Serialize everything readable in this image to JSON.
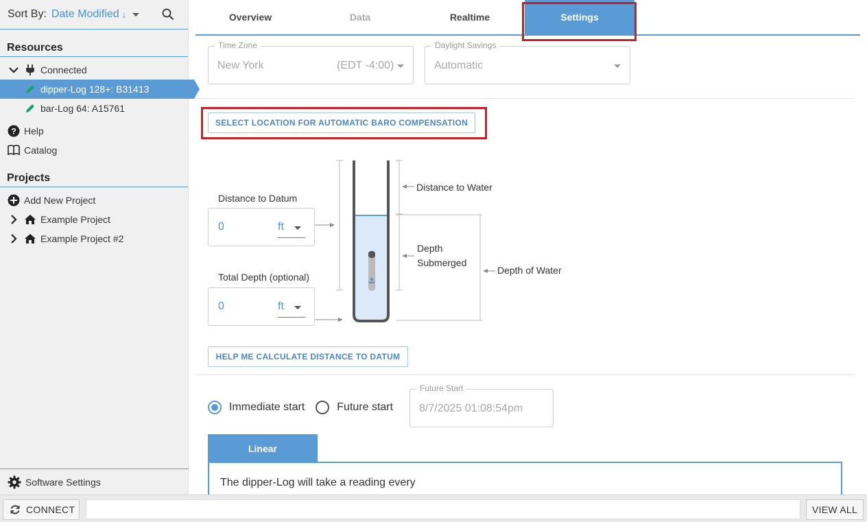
{
  "sidebar": {
    "sort_label": "Sort By:",
    "sort_value": "Date Modified",
    "sort_direction_glyph": "↓",
    "resources_title": "Resources",
    "resources": [
      {
        "label": "Connected",
        "icon": "plug-icon",
        "expanded": true
      },
      {
        "label": "dipper-Log 128+: B31413",
        "icon": "pencil-icon",
        "selected": true
      },
      {
        "label": "bar-Log 64: A15761",
        "icon": "pencil-icon"
      },
      {
        "label": "Help",
        "icon": "help-circle-icon"
      },
      {
        "label": "Catalog",
        "icon": "book-icon"
      }
    ],
    "projects_title": "Projects",
    "projects": [
      {
        "label": "Add New Project",
        "icon": "plus-circle-icon"
      },
      {
        "label": "Example Project",
        "icon": "home-icon"
      },
      {
        "label": "Example Project #2",
        "icon": "home-icon"
      }
    ],
    "software_settings": "Software Settings"
  },
  "tabs": [
    {
      "label": "Overview",
      "state": "normal"
    },
    {
      "label": "Data",
      "state": "disabled"
    },
    {
      "label": "Realtime",
      "state": "normal"
    },
    {
      "label": "Settings",
      "state": "active"
    }
  ],
  "settings": {
    "timezone": {
      "label": "Time Zone",
      "value": "New York",
      "offset": "(EDT -4:00)"
    },
    "daylight": {
      "label": "Daylight Savings",
      "value": "Automatic"
    },
    "baro_button": "SELECT LOCATION FOR AUTOMATIC BARO COMPENSATION",
    "distance_to_datum": {
      "label": "Distance to Datum",
      "value": "0",
      "unit": "ft"
    },
    "total_depth": {
      "label": "Total Depth (optional)",
      "value": "0",
      "unit": "ft"
    },
    "diagram": {
      "distance_to_water": "Distance to Water",
      "depth_submerged_1": "Depth",
      "depth_submerged_2": "Submerged",
      "depth_of_water": "Depth of Water"
    },
    "help_button": "HELP ME CALCULATE DISTANCE TO DATUM",
    "start": {
      "immediate": "Immediate start",
      "future": "Future start",
      "selected": "immediate",
      "future_label": "Future Start",
      "future_value": "8/7/2025 01:08:54pm"
    },
    "mode_tab": "Linear",
    "reading_text": "The dipper-Log will take a reading every"
  },
  "bottom": {
    "connect": "CONNECT",
    "view_all": "VIEW ALL"
  },
  "colors": {
    "accent": "#5b9bd5",
    "highlight_box": "#c81e24"
  }
}
